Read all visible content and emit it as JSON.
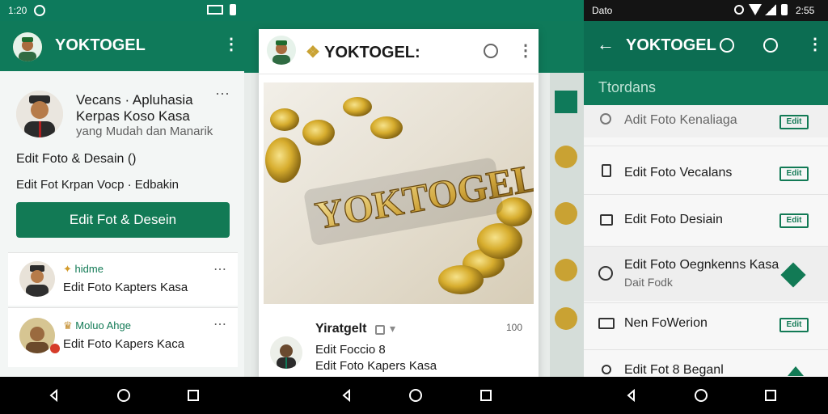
{
  "status": {
    "left_time": "1:20",
    "right_label": "Dato",
    "right_time": "2:55"
  },
  "left_screen": {
    "app_title": "YOKTOGEL",
    "profile": {
      "name_line1": "Vecans · Apluhasia",
      "name_line2": "Kerpas Koso Kasa",
      "subtitle": "yang Mudah dan Manarik"
    },
    "line1": "Edit Foto & Desain ()",
    "line2": "Edit Fot Krpan Vocp · Edbakin",
    "primary_button": "Edit Fot & Desein",
    "list": [
      {
        "name": "hidme",
        "desc": "Edit Foto Kapters Kasa"
      },
      {
        "name": "Moluo Ahge",
        "desc": "Edit Foto Kapers Kaca"
      }
    ]
  },
  "middle_screen": {
    "app_title": "YOKTOGEL:",
    "post": {
      "author": "Yiratgelt",
      "count": "100",
      "line1": "Edit Foccio 8",
      "line2": "Edit Foto Kapers Kasa"
    },
    "image_text": "YOKTOGEL"
  },
  "right_screen": {
    "app_title": "YOKTOGEL",
    "sub_tab": "Ttordans",
    "rows": [
      {
        "label": "Adit Foto Kenaliaga",
        "badge": "Edit"
      },
      {
        "label": "Edit Foto Vecalans",
        "badge": "Edit"
      },
      {
        "label": "Edit Foto Desiain",
        "badge": "Edit"
      },
      {
        "label": "Edit Foto Oegnkenns Kasa",
        "sublabel": "Dait Fodk",
        "badge": ""
      },
      {
        "label": "Nen FoWerion",
        "badge": "Edit"
      },
      {
        "label": "Edit Fot 8 Beganl",
        "badge": ""
      }
    ]
  },
  "colors": {
    "brand_green": "#0f7a5a",
    "accent_gold": "#c9a233"
  }
}
